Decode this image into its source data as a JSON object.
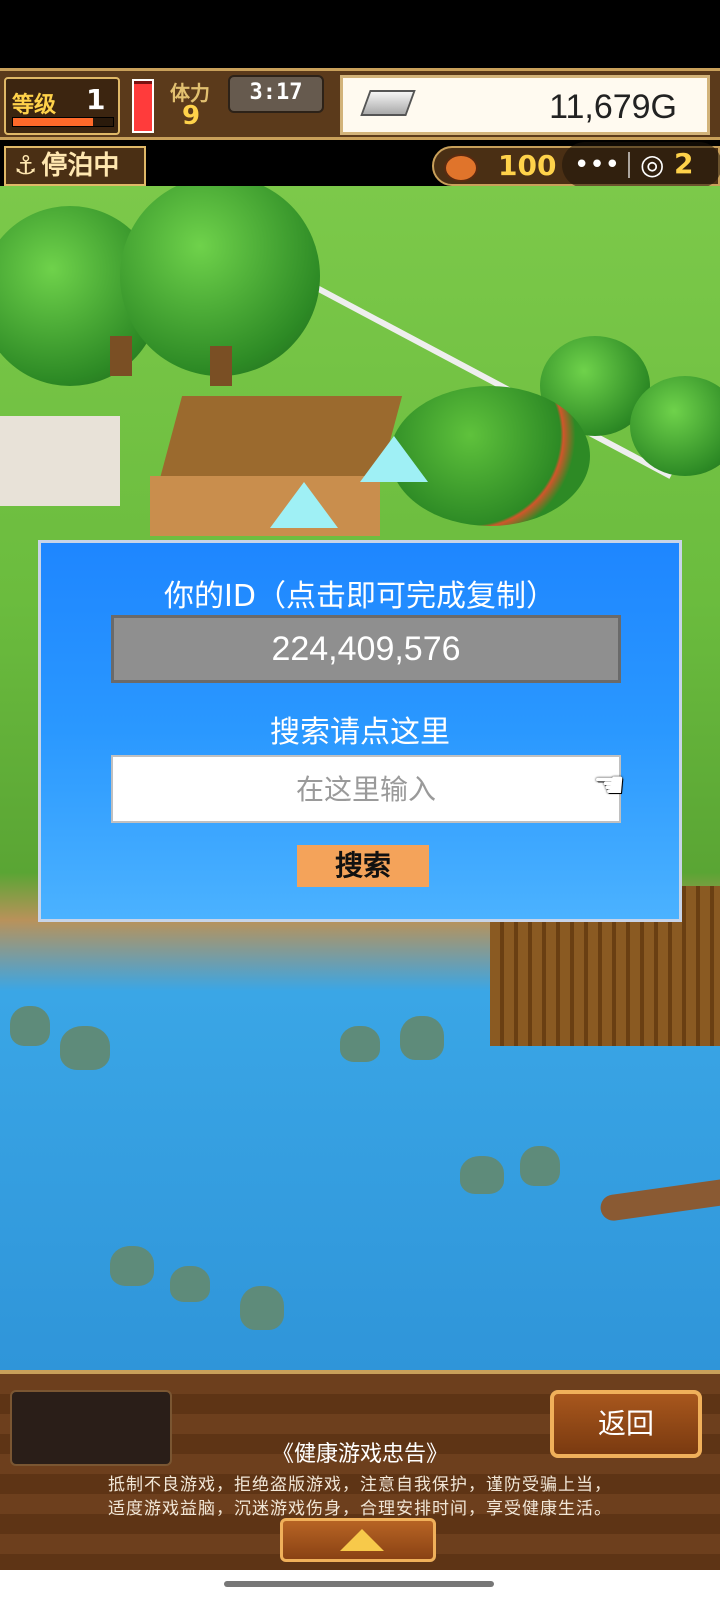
{
  "hud": {
    "level_label": "等级",
    "level_value": "1",
    "stamina_label": "体力",
    "stamina_value": "9",
    "timer": "3:17",
    "gold": "11,679G",
    "dock_status": "停泊中",
    "food_value": "100",
    "other_value": "2",
    "level_exp_fraction": 0.8,
    "stamina_fill_fraction": 0.95
  },
  "dialog": {
    "title": "你的ID（点击即可完成复制）",
    "player_id": "224,409,576",
    "search_label": "搜索请点这里",
    "search_placeholder": "在这里输入",
    "search_button": "搜索"
  },
  "bottom": {
    "return_button": "返回",
    "advisory_title": "《健康游戏忠告》",
    "advisory_line1": "抵制不良游戏，拒绝盗版游戏，注意自我保护，谨防受骗上当，",
    "advisory_line2": "适度游戏益脑，沉迷游戏伤身，合理安排时间，享受健康生活。"
  },
  "icons": {
    "anchor": "anchor-icon",
    "silver": "silver-ingot-icon",
    "food": "food-icon",
    "menu": "more-dots-icon",
    "target": "target-icon",
    "hand": "pointing-hand-icon",
    "up": "up-arrow-icon"
  }
}
